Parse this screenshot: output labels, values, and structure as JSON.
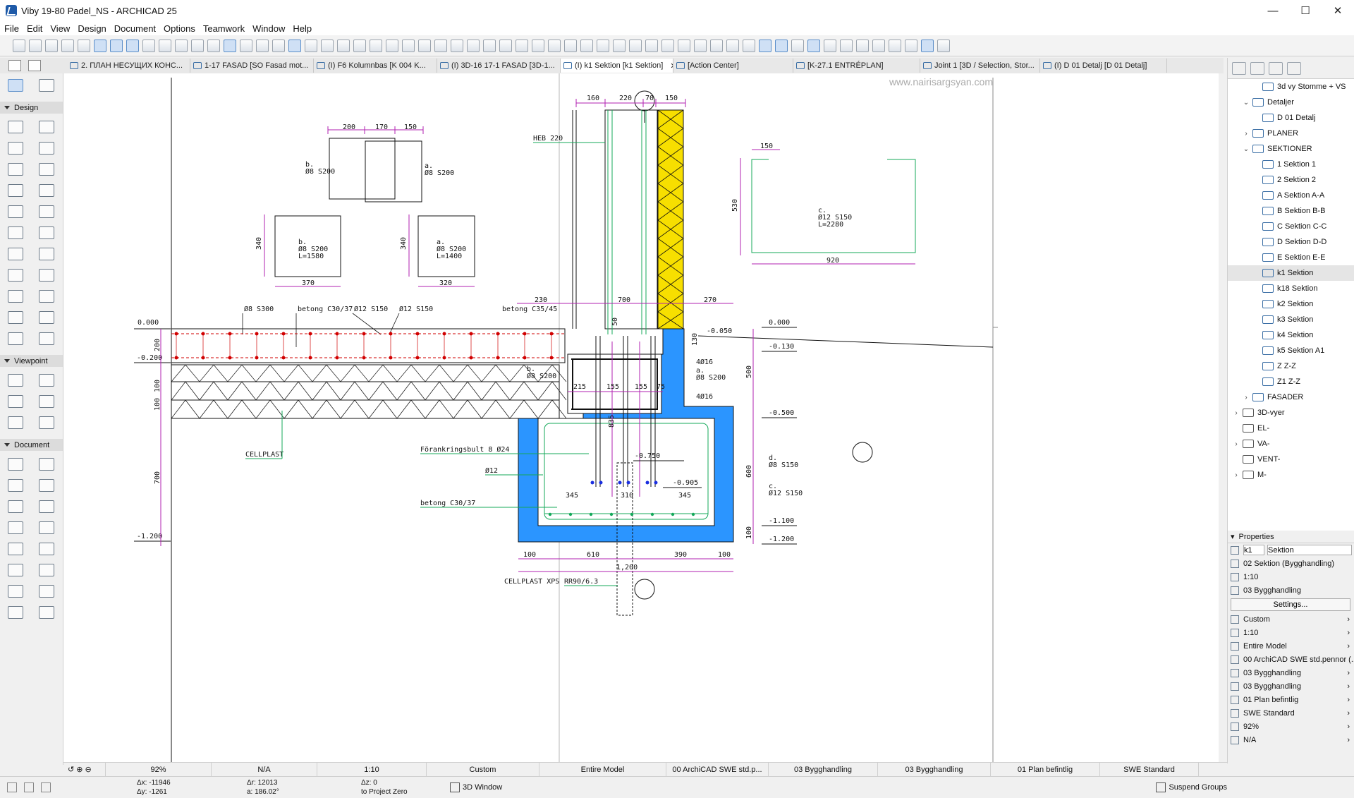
{
  "window": {
    "title": "Viby 19-80 Padel_NS - ARCHICAD 25",
    "controls": [
      "—",
      "☐",
      "✕"
    ]
  },
  "menu": [
    "File",
    "Edit",
    "View",
    "Design",
    "Document",
    "Options",
    "Teamwork",
    "Window",
    "Help"
  ],
  "tabs": [
    {
      "label": "2. ПЛАН НЕСУЩИХ КОНС...",
      "active": false
    },
    {
      "label": "1-17 FASAD [SO Fasad mot...",
      "active": false
    },
    {
      "label": "(I) F6 Kolumnbas [K 004 K...",
      "active": false
    },
    {
      "label": "(I) 3D-16 17-1 FASAD [3D-1...",
      "active": false
    },
    {
      "label": "(I) k1 Sektion [k1 Sektion]",
      "active": true,
      "close": "✕"
    },
    {
      "label": "[Action Center]",
      "active": false
    },
    {
      "label": "[K-27.1 ENTRÉPLAN]",
      "active": false
    },
    {
      "label": "Joint 1 [3D / Selection, Stor...",
      "active": false
    },
    {
      "label": "(I) D 01 Detalj [D 01 Detalj]",
      "active": false
    }
  ],
  "toolbox": {
    "design_label": "Design",
    "viewpoint_label": "Viewpoint",
    "document_label": "Document"
  },
  "watermark": "www.nairisargsyan.com",
  "drawing": {
    "labels": {
      "heb": "HEB 220",
      "b_s200_1": "b.",
      "b_s200_1b": "Ø8 S200",
      "a_s200_1": "a.",
      "a_s200_1b": "Ø8 S200",
      "b_box": "b.",
      "b_box2": "Ø8 S200",
      "b_box3": "L=1580",
      "a_box": "a.",
      "a_box2": "Ø8 S200",
      "a_box3": "L=1400",
      "c_box": "c.",
      "c_box2": "Ø12 S150",
      "c_box3": "L=2280",
      "s300": "Ø8 S300",
      "c3037_top": "betong C30/37",
      "s150a": "Ø12 S150",
      "s150b": "Ø12 S150",
      "c3545": "betong C35/45",
      "cellplast": "CELLPLAST",
      "bolt": "Förankringsbult 8 Ø24",
      "o12": "Ø12",
      "c3037_bot": "betong C30/37",
      "cellplast_xps": "CELLPLAST XPS",
      "rr": "RR90/6.3",
      "b_mid": "b.",
      "b_mid2": "Ø8 S200",
      "a_mid": "a.",
      "a_mid2": "Ø8 S200",
      "bars_4016a": "4Ø16",
      "bars_4016b": "4Ø16",
      "d_s150": "d.",
      "d_s150b": "Ø8 S150",
      "c_s150": "c.",
      "c_s150b": "Ø12 S150"
    },
    "levels": {
      "l0": "0.000",
      "l020": "-0.200",
      "l120": "-1.200",
      "r0": "0.000",
      "r013": "-0.130",
      "r050": "-0.500",
      "r110": "-1.100",
      "r120": "-1.200",
      "m005": "-0.050",
      "m075": "-0.750",
      "m0905": "-0.905"
    },
    "dims": {
      "d160": "160",
      "d220": "220",
      "d70": "70",
      "d150": "150",
      "d200": "200",
      "d170": "170",
      "d150b": "150",
      "d340a": "340",
      "d370": "370",
      "d340b": "340",
      "d320": "320",
      "d150c": "150",
      "d530": "530",
      "d920": "920",
      "d230": "230",
      "d700": "700",
      "d270": "270",
      "d200v": "200",
      "d100a": "100",
      "d100b": "100",
      "d700v": "700",
      "d50": "50",
      "d130": "130",
      "d215": "215",
      "d155a": "155",
      "d155b": "155",
      "d75": "75",
      "d835": "835",
      "d500": "500",
      "d600": "600",
      "d100v": "100",
      "d345a": "345",
      "d310": "310",
      "d345b": "345",
      "d100c": "100",
      "d610": "610",
      "d390": "390",
      "d100d": "100",
      "d1200": "1,200"
    }
  },
  "navigator": {
    "items": [
      {
        "label": "3d vy Stomme + VS",
        "indent": 2,
        "icon": "view",
        "chev": ""
      },
      {
        "label": "Detaljer",
        "indent": 1,
        "icon": "view",
        "chev": "v"
      },
      {
        "label": "D 01 Detalj",
        "indent": 2,
        "icon": "view",
        "chev": ""
      },
      {
        "label": "PLANER",
        "indent": 1,
        "icon": "view",
        "chev": ">"
      },
      {
        "label": "SEKTIONER",
        "indent": 1,
        "icon": "view",
        "chev": "v"
      },
      {
        "label": "1 Sektion 1",
        "indent": 2,
        "icon": "view",
        "chev": ""
      },
      {
        "label": "2 Sektion 2",
        "indent": 2,
        "icon": "view",
        "chev": ""
      },
      {
        "label": "A Sektion A-A",
        "indent": 2,
        "icon": "view",
        "chev": ""
      },
      {
        "label": "B Sektion B-B",
        "indent": 2,
        "icon": "view",
        "chev": ""
      },
      {
        "label": "C Sektion C-C",
        "indent": 2,
        "icon": "view",
        "chev": ""
      },
      {
        "label": "D Sektion D-D",
        "indent": 2,
        "icon": "view",
        "chev": ""
      },
      {
        "label": "E Sektion E-E",
        "indent": 2,
        "icon": "view",
        "chev": ""
      },
      {
        "label": "k1 Sektion",
        "indent": 2,
        "icon": "view",
        "chev": "",
        "selected": true
      },
      {
        "label": "k18 Sektion",
        "indent": 2,
        "icon": "view",
        "chev": ""
      },
      {
        "label": "k2 Sektion",
        "indent": 2,
        "icon": "view",
        "chev": ""
      },
      {
        "label": "k3 Sektion",
        "indent": 2,
        "icon": "view",
        "chev": ""
      },
      {
        "label": "k4 Sektion",
        "indent": 2,
        "icon": "view",
        "chev": ""
      },
      {
        "label": "k5 Sektion A1",
        "indent": 2,
        "icon": "view",
        "chev": ""
      },
      {
        "label": "Z Z-Z",
        "indent": 2,
        "icon": "view",
        "chev": ""
      },
      {
        "label": "Z1 Z-Z",
        "indent": 2,
        "icon": "view",
        "chev": ""
      },
      {
        "label": "FASADER",
        "indent": 1,
        "icon": "view",
        "chev": ">"
      },
      {
        "label": "3D-vyer",
        "indent": 0,
        "icon": "folder",
        "chev": ">"
      },
      {
        "label": "EL-",
        "indent": 0,
        "icon": "folder",
        "chev": ""
      },
      {
        "label": "VA-",
        "indent": 0,
        "icon": "folder",
        "chev": ">"
      },
      {
        "label": "VENT-",
        "indent": 0,
        "icon": "folder",
        "chev": ""
      },
      {
        "label": "M-",
        "indent": 0,
        "icon": "folder",
        "chev": ">"
      }
    ]
  },
  "properties": {
    "header": "Properties",
    "id_value": "k1",
    "name_value": "Sektion",
    "rows": [
      "02 Sektion (Bygghandling)",
      "1:10",
      "03 Bygghandling"
    ],
    "settings": "Settings...",
    "more": [
      "Custom",
      "1:10",
      "Entire Model",
      "00 ArchiCAD SWE std.pennor (...",
      "03 Bygghandling",
      "03 Bygghandling",
      "01 Plan befintlig",
      "SWE Standard",
      "92%",
      "N/A"
    ]
  },
  "statusbar": {
    "zoom": "92%",
    "na": "N/A",
    "scale": "1:10",
    "custom": "Custom",
    "model": "Entire Model",
    "pens": "00 ArchiCAD SWE std.p...",
    "byg1": "03 Bygghandling",
    "byg2": "03 Bygghandling",
    "plan": "01 Plan befintlig",
    "std": "SWE Standard"
  },
  "coords": {
    "dx": "Δx: -11946",
    "dy": "Δy: -1261",
    "dr": "Δr: 12013",
    "angle": "a: 186.02°",
    "dz": "Δz: 0",
    "zero": "to Project Zero",
    "window3d": "3D Window",
    "suspend": "Suspend Groups"
  },
  "colors": {
    "yellow": "#f7df00",
    "blue": "#2b95ff",
    "magenta": "#b021b0",
    "green": "#14a85a",
    "red": "#d10000"
  }
}
